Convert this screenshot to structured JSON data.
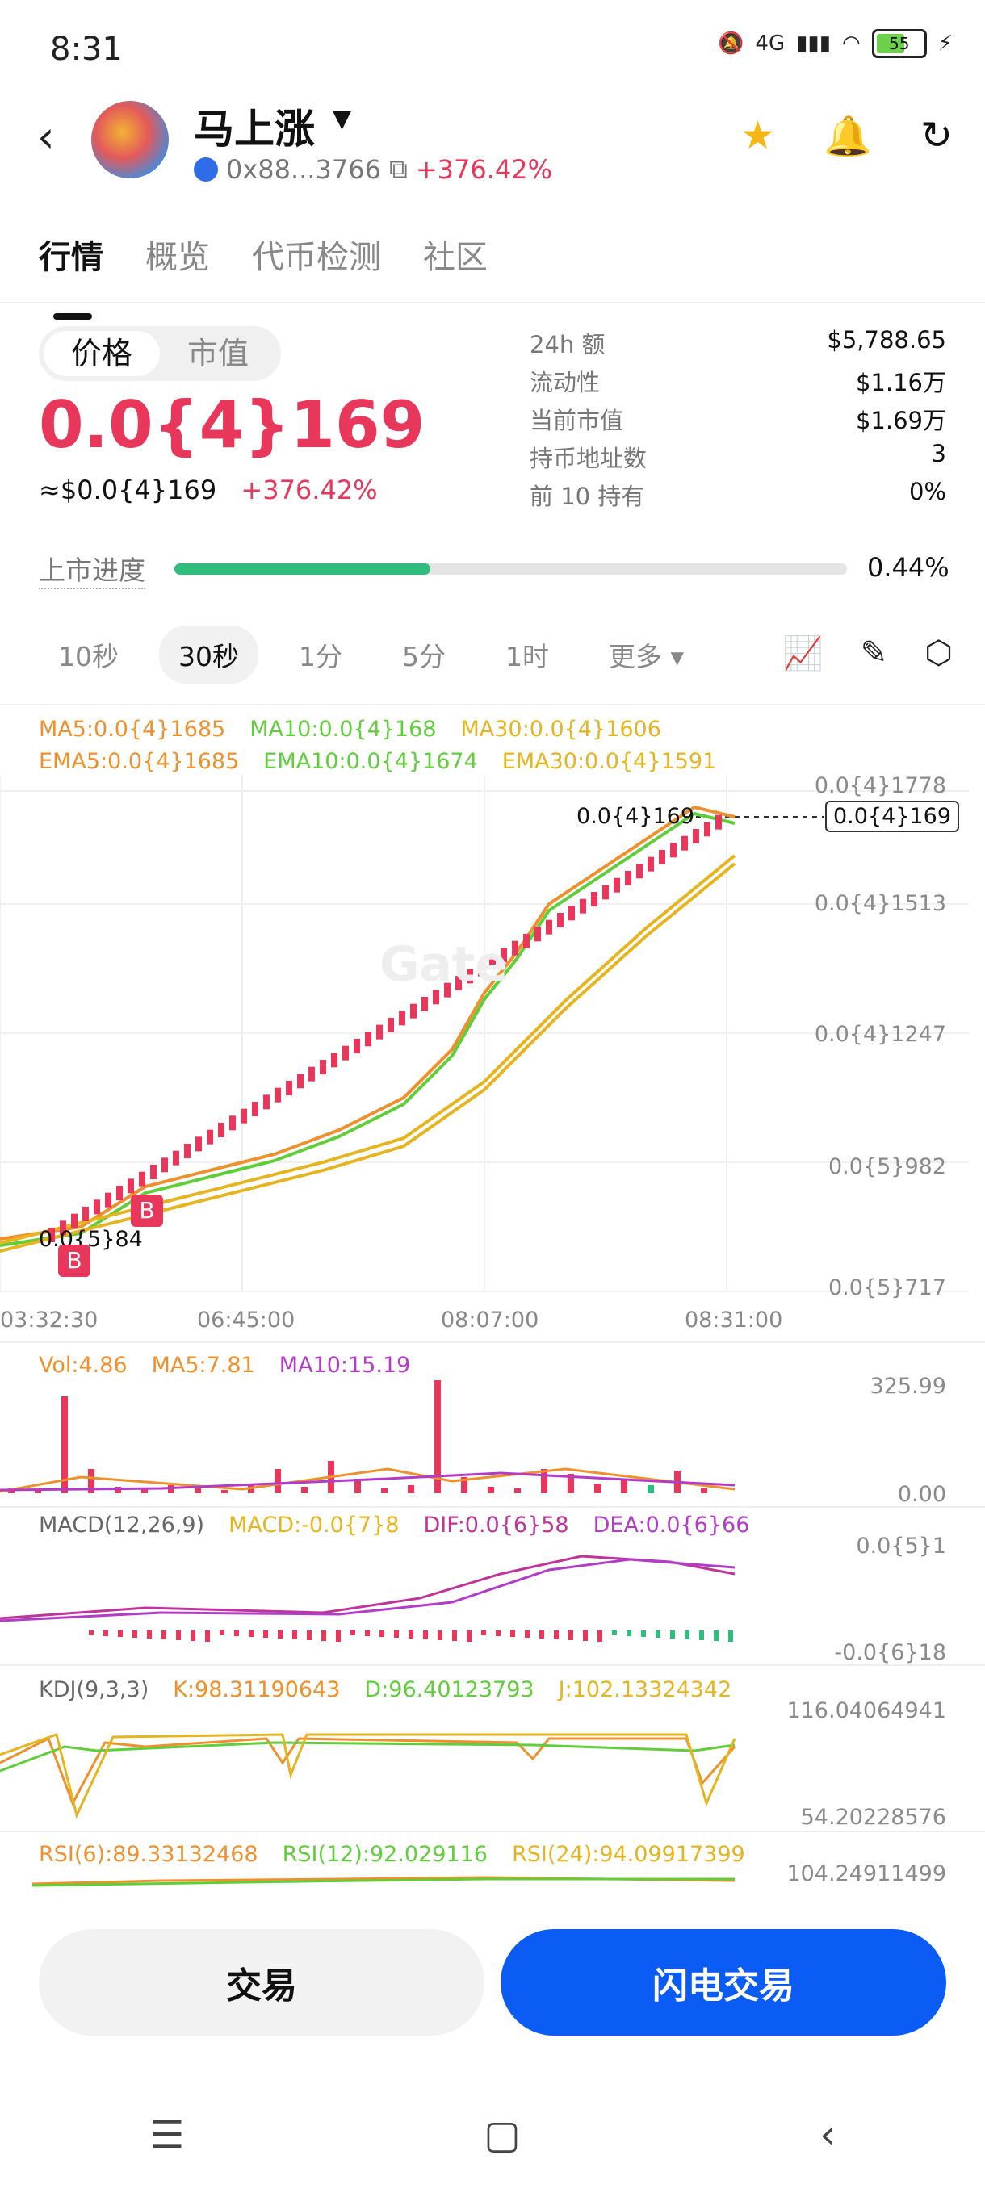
{
  "status": {
    "time": "8:31",
    "network": "4G",
    "battery": "55"
  },
  "header": {
    "coin_name": "马上涨",
    "address": "0x88...3766",
    "change": "+376.42%"
  },
  "tabs": [
    "行情",
    "概览",
    "代币检测",
    "社区"
  ],
  "price_toggle": {
    "price_label": "价格",
    "mcap_label": "市值"
  },
  "price": {
    "value": "0.0{4}169",
    "usd": "≈$0.0{4}169",
    "change": "+376.42%"
  },
  "stats": [
    {
      "k": "24h  额",
      "v": "$5,788.65"
    },
    {
      "k": "流动性",
      "v": "$1.16万"
    },
    {
      "k": "当前市值",
      "v": "$1.69万"
    },
    {
      "k": "持币地址数",
      "v": "3"
    },
    {
      "k": "前 10 持有",
      "v": "0%"
    }
  ],
  "launch": {
    "label": "上市进度",
    "value": "0.44%",
    "progress": 0.44
  },
  "intervals": [
    "10秒",
    "30秒",
    "1分",
    "5分",
    "1时",
    "更多"
  ],
  "indicators": {
    "ma_line": [
      {
        "t": "MA5:0.0{4}1685",
        "c": "#f0902c"
      },
      {
        "t": "MA10:0.0{4}168",
        "c": "#5fce3a"
      },
      {
        "t": "MA30:0.0{4}1606",
        "c": "#e6b41e"
      }
    ],
    "ema_line": [
      {
        "t": "EMA5:0.0{4}1685",
        "c": "#f0902c"
      },
      {
        "t": "EMA10:0.0{4}1674",
        "c": "#5fce3a"
      },
      {
        "t": "EMA30:0.0{4}1591",
        "c": "#e6b41e"
      }
    ],
    "vol_line": [
      {
        "t": "Vol:4.86",
        "c": "#f0902c"
      },
      {
        "t": "MA5:7.81",
        "c": "#f0902c"
      },
      {
        "t": "MA10:15.19",
        "c": "#b23cc8"
      }
    ],
    "macd_line": [
      {
        "t": "MACD(12,26,9)",
        "c": "#666666"
      },
      {
        "t": "MACD:-0.0{7}8",
        "c": "#e6b41e"
      },
      {
        "t": "DIF:0.0{6}58",
        "c": "#c0339b"
      },
      {
        "t": "DEA:0.0{6}66",
        "c": "#b23cc8"
      }
    ],
    "kdj_line": [
      {
        "t": "KDJ(9,3,3)",
        "c": "#666666"
      },
      {
        "t": "K:98.31190643",
        "c": "#f0902c"
      },
      {
        "t": "D:96.40123793",
        "c": "#5fce3a"
      },
      {
        "t": "J:102.13324342",
        "c": "#e6b41e"
      }
    ],
    "rsi_line": [
      {
        "t": "RSI(6):89.33132468",
        "c": "#f0902c"
      },
      {
        "t": "RSI(12):92.029116",
        "c": "#5fce3a"
      },
      {
        "t": "RSI(24):94.09917399",
        "c": "#e6b41e"
      }
    ]
  },
  "chart_data": {
    "type": "line",
    "price_axis": [
      "0.0{4}1778",
      "0.0{4}1513",
      "0.0{4}1247",
      "0.0{5}982",
      "0.0{5}717"
    ],
    "time_axis": [
      "03:32:30",
      "06:45:00",
      "08:07:00",
      "08:31:00"
    ],
    "current_price_tag": "0.0{4}169",
    "high_label": "0.0{4}169",
    "low_label": "0.0{5}84",
    "buy_marker": "B",
    "vol_axis": [
      "325.99",
      "0.00"
    ],
    "macd_axis": [
      "0.0{5}1",
      "-0.0{6}18"
    ],
    "kdj_axis": [
      "116.04064941",
      "54.20228576"
    ],
    "rsi_axis": [
      "104.24911499"
    ],
    "watermark": "Gate"
  },
  "actions": {
    "trade": "交易",
    "flash_trade": "闪电交易"
  }
}
